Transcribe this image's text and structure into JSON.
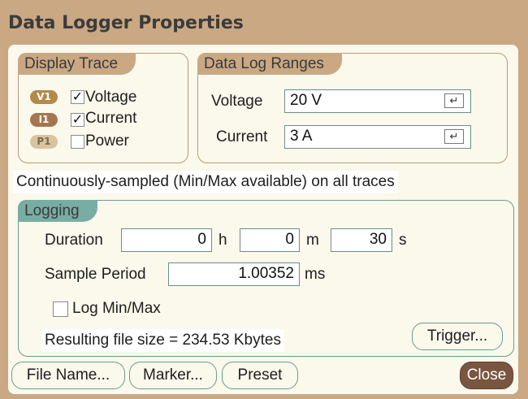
{
  "window": {
    "title": "Data Logger Properties"
  },
  "display_trace": {
    "title": "Display Trace",
    "items": [
      {
        "badge": "V1",
        "label": "Voltage",
        "checked": true,
        "badge_color": "#b28a4a",
        "badge_text_color": "#ffffff"
      },
      {
        "badge": "I1",
        "label": "Current",
        "checked": true,
        "badge_color": "#a47650",
        "badge_text_color": "#ffffff"
      },
      {
        "badge": "P1",
        "label": "Power",
        "checked": false,
        "badge_color": "#d9c3a0",
        "badge_text_color": "#7a6a50"
      }
    ]
  },
  "data_log_ranges": {
    "title": "Data Log Ranges",
    "voltage_label": "Voltage",
    "voltage_value": "20 V",
    "current_label": "Current",
    "current_value": "3 A",
    "dropdown_icon": "↵"
  },
  "sampling_note": "Continuously-sampled (Min/Max available)  on all traces",
  "logging": {
    "title": "Logging",
    "duration_label": "Duration",
    "hours": "0",
    "hours_unit": "h",
    "minutes": "0",
    "minutes_unit": "m",
    "seconds": "30",
    "seconds_unit": "s",
    "sample_period_label": "Sample Period",
    "sample_period": "1.00352",
    "sample_period_unit": "ms",
    "log_minmax_label": "Log Min/Max",
    "log_minmax_checked": false,
    "file_size_text": "Resulting file size = 234.53 Kbytes",
    "trigger_button": "Trigger..."
  },
  "buttons": {
    "file_name": "File Name...",
    "marker": "Marker...",
    "preset": "Preset",
    "close": "Close"
  },
  "colors": {
    "frame": "#c9a883",
    "panel": "#fbf8ec",
    "teal": "#78ada3",
    "close_button": "#7a5540"
  }
}
